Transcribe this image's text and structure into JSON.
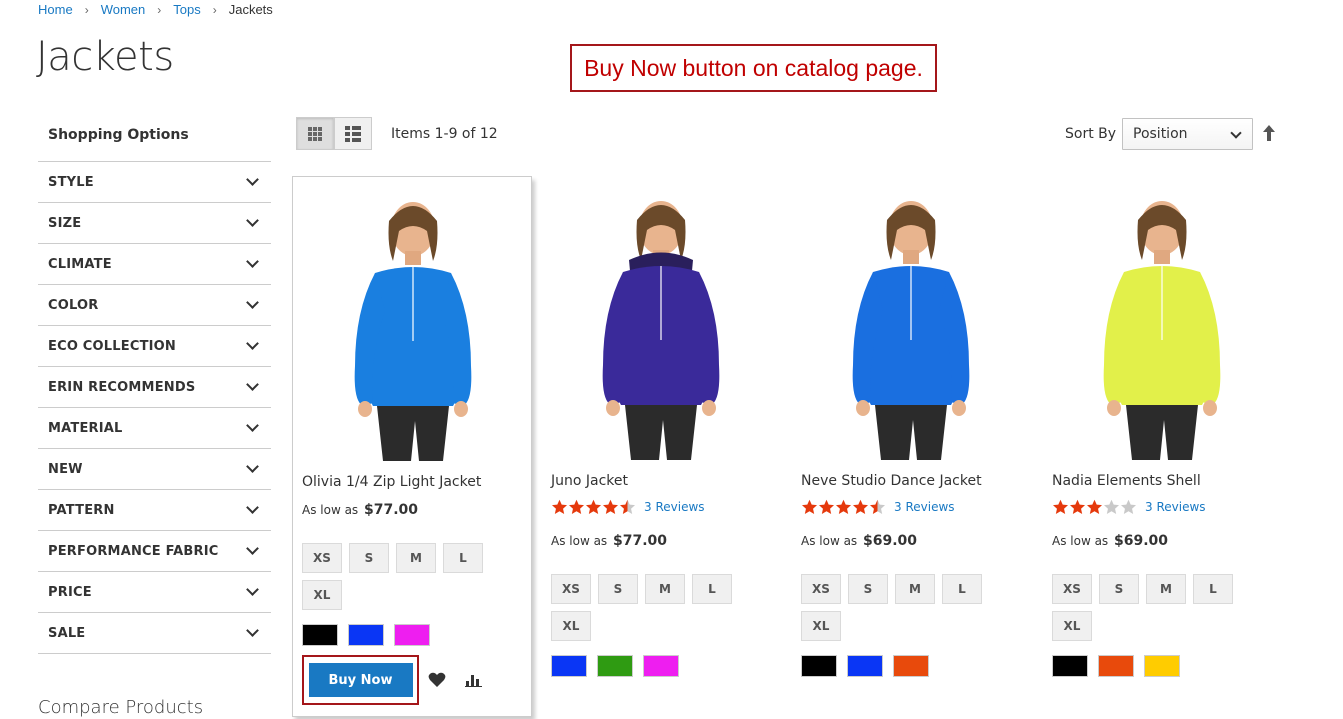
{
  "breadcrumb": {
    "items": [
      "Home",
      "Women",
      "Tops"
    ],
    "current": "Jackets"
  },
  "page_title": "Jackets",
  "annotation": "Buy Now button on catalog page.",
  "sidebar": {
    "title": "Shopping Options",
    "filters": [
      "STYLE",
      "SIZE",
      "CLIMATE",
      "COLOR",
      "ECO COLLECTION",
      "ERIN RECOMMENDS",
      "MATERIAL",
      "NEW",
      "PATTERN",
      "PERFORMANCE FABRIC",
      "PRICE",
      "SALE"
    ],
    "compare_title": "Compare Products"
  },
  "toolbar": {
    "items_count": "Items 1-9 of 12",
    "sort_label": "Sort By",
    "sort_value": "Position"
  },
  "products": [
    {
      "name": "Olivia 1/4 Zip Light Jacket",
      "price_label": "As low as",
      "price": "$77.00",
      "sizes": [
        "XS",
        "S",
        "M",
        "L",
        "XL"
      ],
      "colors": [
        "#000000",
        "#0a36f5",
        "#ee1ef0"
      ],
      "buy_label": "Buy Now",
      "jacket_color": "#1a7fe0"
    },
    {
      "name": "Juno Jacket",
      "rating": 4.5,
      "reviews": "3 Reviews",
      "price_label": "As low as",
      "price": "$77.00",
      "sizes": [
        "XS",
        "S",
        "M",
        "L",
        "XL"
      ],
      "colors": [
        "#0a36f5",
        "#2f9b12",
        "#ee1ef0"
      ],
      "jacket_color": "#3a2a9a"
    },
    {
      "name": "Neve Studio Dance Jacket",
      "rating": 4.5,
      "reviews": "3 Reviews",
      "price_label": "As low as",
      "price": "$69.00",
      "sizes": [
        "XS",
        "S",
        "M",
        "L",
        "XL"
      ],
      "colors": [
        "#000000",
        "#0a36f5",
        "#e84a0c"
      ],
      "jacket_color": "#1a6fe0"
    },
    {
      "name": "Nadia Elements Shell",
      "rating": 3,
      "reviews": "3 Reviews",
      "price_label": "As low as",
      "price": "$69.00",
      "sizes": [
        "XS",
        "S",
        "M",
        "L",
        "XL"
      ],
      "colors": [
        "#000000",
        "#e84a0c",
        "#ffcc00"
      ],
      "jacket_color": "#e2f04a"
    }
  ]
}
